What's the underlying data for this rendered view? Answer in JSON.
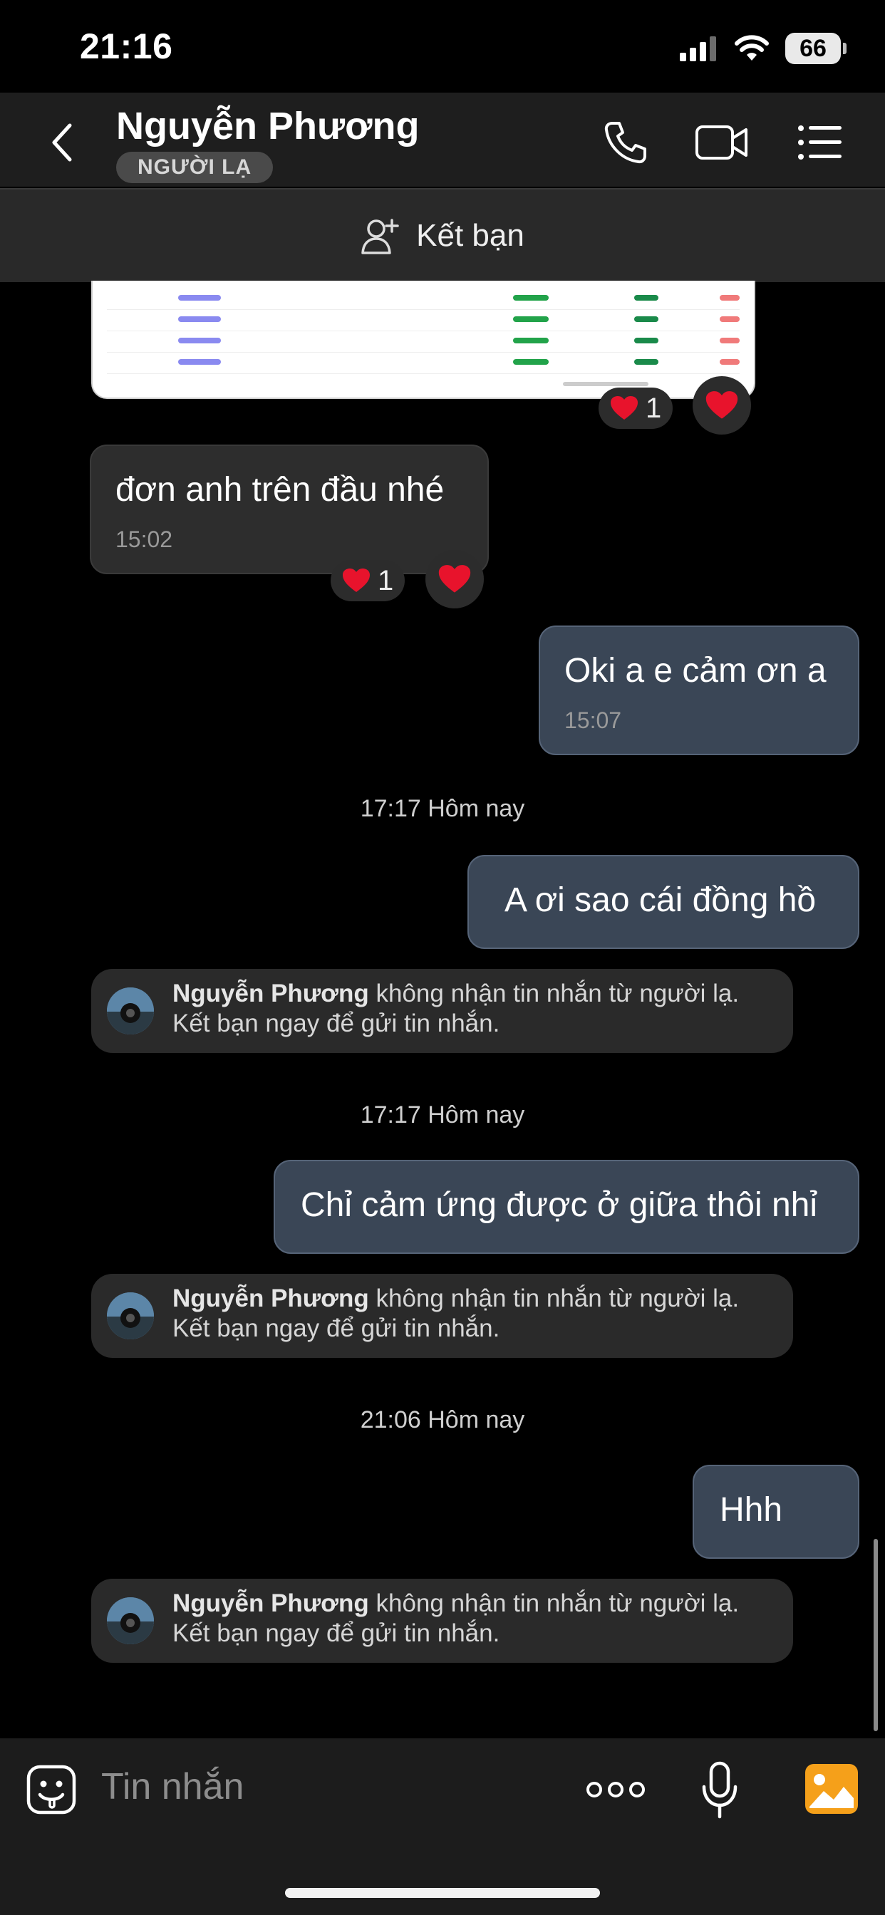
{
  "status_bar": {
    "time": "21:16",
    "battery": "66"
  },
  "header": {
    "name": "Nguyễn Phương",
    "badge": "NGƯỜI LẠ"
  },
  "friend_bar": {
    "label": "Kết bạn"
  },
  "messages": [
    {
      "id": "image",
      "type": "image",
      "reaction_count": "1"
    },
    {
      "id": "m1",
      "direction": "in",
      "text": "đơn anh trên đầu nhé",
      "time": "15:02",
      "reaction_count": "1"
    },
    {
      "id": "m2",
      "direction": "out",
      "text": "Oki a e cảm ơn a",
      "time": "15:07"
    },
    {
      "id": "m3",
      "direction": "out",
      "text": "A ơi sao cái đồng hồ"
    },
    {
      "id": "m4",
      "direction": "out",
      "text": "Chỉ cảm ứng được ở giữa thôi nhỉ"
    },
    {
      "id": "m5",
      "direction": "out",
      "text": "Hhh"
    }
  ],
  "timestamps": [
    "17:17 Hôm nay",
    "17:17 Hôm nay",
    "21:06 Hôm nay"
  ],
  "notice": {
    "name": "Nguyễn Phương",
    "text": " không nhận tin nhắn từ người lạ.",
    "line2": "Kết bạn ngay để gửi tin nhắn."
  },
  "input": {
    "placeholder": "Tin nhắn"
  },
  "icons": {
    "back": "chevron-left-icon",
    "call": "phone-icon",
    "video": "video-camera-icon",
    "menu": "list-icon",
    "add_friend": "add-user-icon",
    "sticker": "sticker-icon",
    "more": "more-dots-icon",
    "mic": "microphone-icon",
    "gallery": "image-icon"
  },
  "colors": {
    "outgoing_bubble": "#3a4656",
    "incoming_bubble": "#2d2d2d",
    "heart": "#e8132c",
    "gallery": "#f5a01a"
  }
}
